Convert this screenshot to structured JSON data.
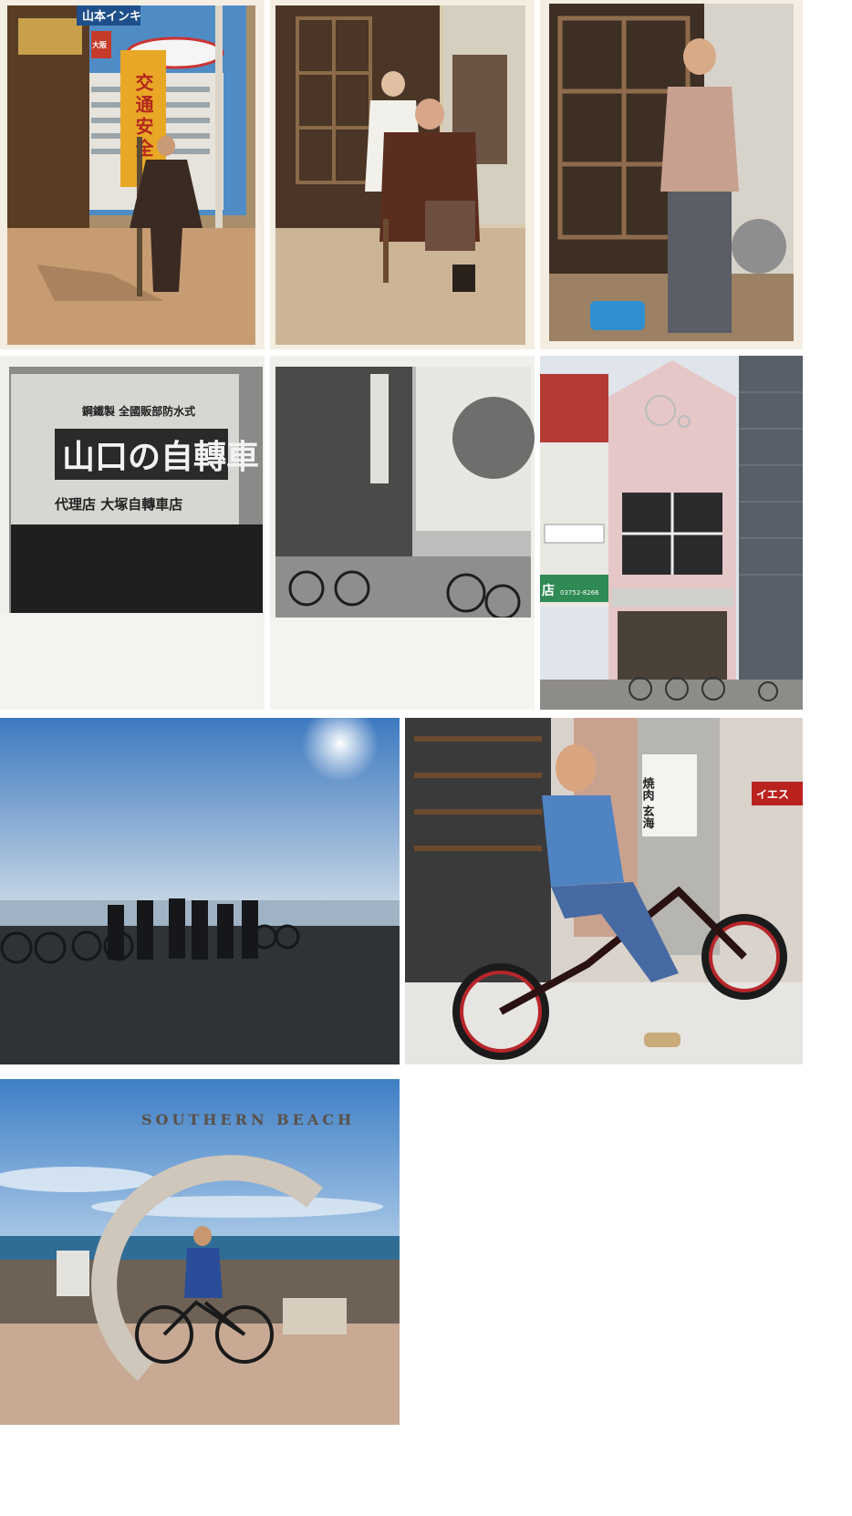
{
  "photos": [
    {
      "id": "p1",
      "sign_ink": "山本インキ",
      "banner": "交通安全",
      "sign_small": "大阪"
    },
    {
      "id": "p2"
    },
    {
      "id": "p3"
    },
    {
      "id": "p4",
      "sign_top": "鋼鐵製 全國販部防水式",
      "sign_main": "山口の自轉車",
      "sign_bottom": "代理店 大塚自轉車店"
    },
    {
      "id": "p5"
    },
    {
      "id": "p6",
      "shop_sign": "店",
      "phone": "03752-8266"
    },
    {
      "id": "p7"
    },
    {
      "id": "p8",
      "neighbor_sign": "焼肉 玄海",
      "neighbor_sign2": "イエス"
    },
    {
      "id": "p9",
      "monument_text": "SOUTHERN BEACH"
    }
  ],
  "colors": {
    "sky_blue": "#4d8fd0",
    "sepia": "#c9b38e",
    "bw_dark": "#333333",
    "bike_red": "#b6262b"
  }
}
